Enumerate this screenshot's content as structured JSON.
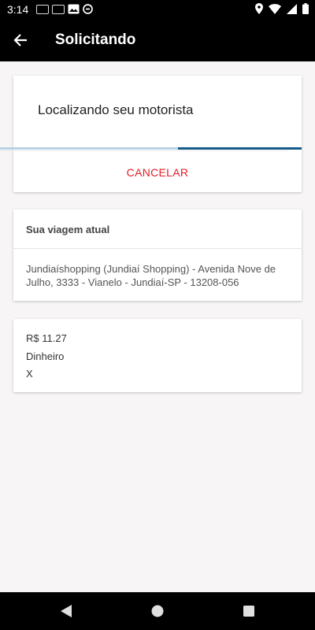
{
  "status_bar": {
    "time": "3:14",
    "notification_icons": [
      "notification-icon",
      "notification-icon",
      "image-icon",
      "no-disturb-icon"
    ],
    "status_icons": [
      "location-icon",
      "wifi-icon",
      "signal-icon",
      "battery-icon"
    ]
  },
  "app_bar": {
    "title": "Solicitando",
    "back_icon": "arrow-left-icon"
  },
  "search_card": {
    "message": "Localizando seu motorista",
    "cancel_label": "CANCELAR",
    "progress_fraction": 0.57,
    "progress_color": "#145b8a",
    "track_color": "#b9d2e3",
    "cancel_color": "#e51c23"
  },
  "trip_card": {
    "header": "Sua viagem atual",
    "address": "Jundiaíshopping (Jundiaí Shopping) - Avenida Nove de Julho, 3333 - Vianelo - Jundiaí-SP - 13208-056"
  },
  "fare_card": {
    "price": "R$ 11.27",
    "payment_method": "Dinheiro",
    "extra": "X"
  },
  "nav_bar": {
    "buttons": [
      "back-triangle-icon",
      "home-circle-icon",
      "recents-square-icon"
    ]
  }
}
